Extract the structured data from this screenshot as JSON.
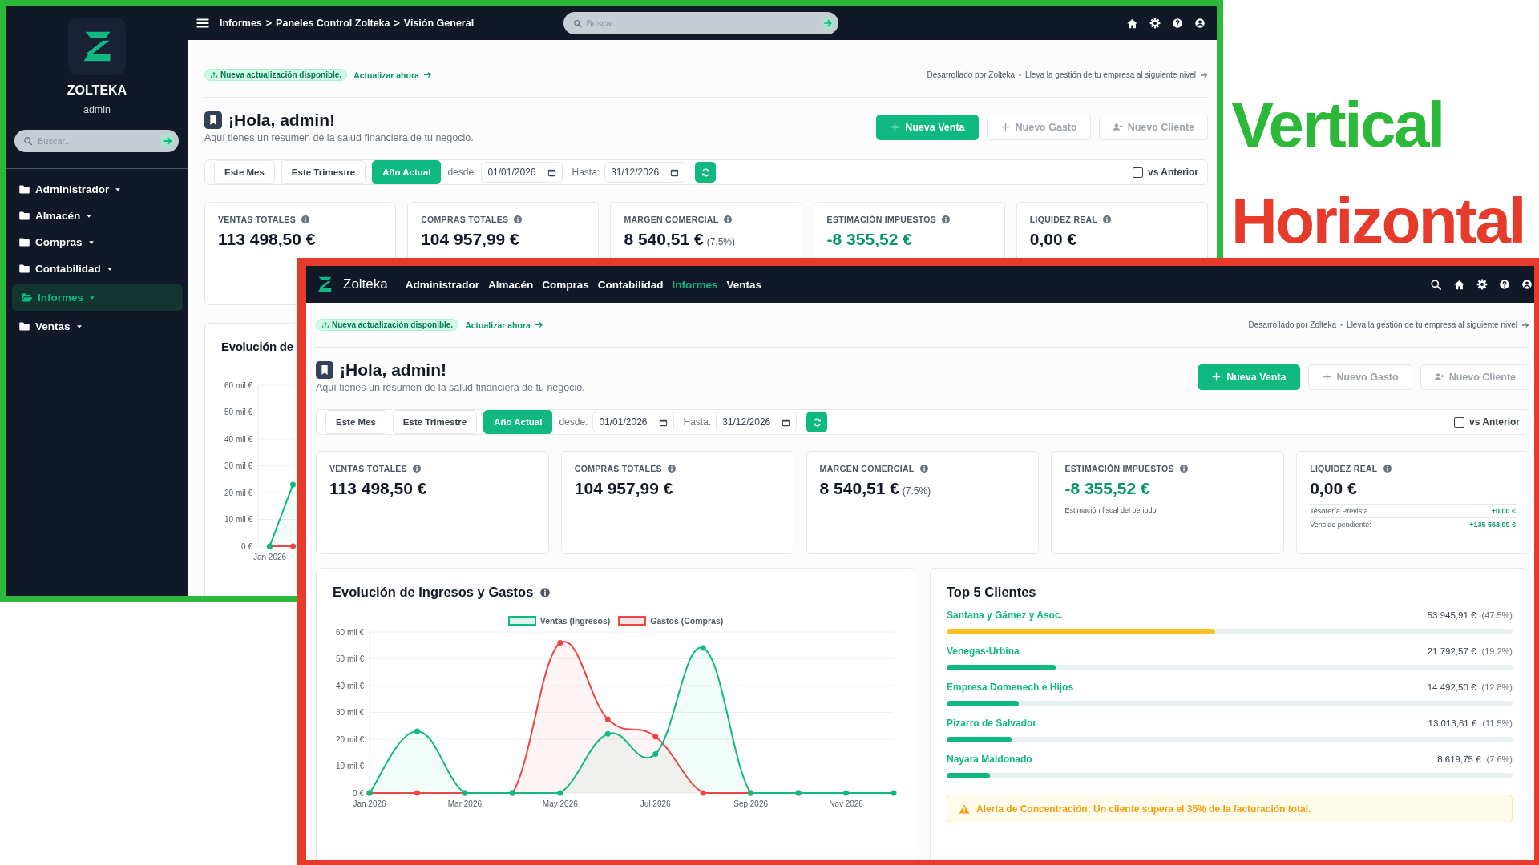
{
  "windows": [
    {
      "kind": "vertical",
      "caption": "Vertical",
      "color": "#2cb93a",
      "sidebar": {
        "brand": "ZOLTEKA",
        "user": "admin",
        "search": {
          "placeholder": "Buscar..."
        },
        "items": [
          {
            "label": "Administrador",
            "selected": false
          },
          {
            "label": "Almacén",
            "selected": false
          },
          {
            "label": "Compras",
            "selected": false
          },
          {
            "label": "Contabilidad",
            "selected": false
          },
          {
            "label": "Informes",
            "selected": true
          },
          {
            "label": "Ventas",
            "selected": false
          }
        ]
      },
      "topbar": {
        "breadcrumb": [
          {
            "label": "Informes",
            "kind": "crumb"
          },
          {
            "label": ">",
            "kind": "separator"
          },
          {
            "label": "Paneles Control Zolteka",
            "kind": "crumb"
          },
          {
            "label": ">",
            "kind": "separator"
          },
          {
            "label": "Visión General",
            "kind": "crumb"
          }
        ],
        "search": {
          "placeholder": "Buscar..."
        }
      },
      "dashboard": {
        "update": {
          "badge": "Nueva actualización disponible.",
          "link": "Actualizar ahora",
          "credit": "Desarrollado por Zolteka",
          "tagline": "Lleva la gestión de tu empresa al siguiente nivel"
        },
        "greeting": {
          "title": "¡Hola, admin!",
          "subtitle": "Aquí tienes un resumen de la salud financiera de tu negocio."
        },
        "actions": [
          {
            "label": "Nueva Venta",
            "kind": "primary"
          },
          {
            "label": "Nuevo Gasto",
            "kind": "secondary"
          },
          {
            "label": "Nuevo Cliente",
            "kind": "contact"
          }
        ],
        "filters": {
          "presets": [
            {
              "label": "Este Mes",
              "selected": false
            },
            {
              "label": "Este Trimestre",
              "selected": false
            },
            {
              "label": "Año Actual",
              "selected": true
            }
          ],
          "from_label": "desde:",
          "from": "01/01/2026",
          "to_label": "Hasta:",
          "to": "31/12/2026",
          "compare": {
            "label": "vs Anterior",
            "checked": false
          }
        },
        "kpis": [
          {
            "title": "VENTAS TOTALES",
            "value": "113 498,50 €",
            "positive": false
          },
          {
            "title": "COMPRAS TOTALES",
            "value": "104 957,99 €",
            "positive": false
          },
          {
            "title": "MARGEN COMERCIAL",
            "value": "8 540,51 €",
            "change": "(7.5%)",
            "positive": false
          },
          {
            "title": "ESTIMACIÓN IMPUESTOS",
            "value": "-8 355,52 €",
            "positive": true
          },
          {
            "title": "LIQUIDEZ REAL",
            "value": "0,00 €",
            "positive": false
          }
        ],
        "evolution": {
          "title": "Evolución de",
          "chart_data": {
            "type": "line",
            "categories": [
              "Jan 2026",
              null,
              null,
              null,
              null,
              null,
              null,
              null,
              null,
              null,
              null,
              null
            ],
            "ylim": [
              0,
              60
            ],
            "yticks": [
              {
                "value": 0,
                "label": "0 €"
              },
              {
                "value": 10,
                "label": "10 mil €"
              },
              {
                "value": 20,
                "label": "20 mil €"
              },
              {
                "value": 30,
                "label": "30 mil €"
              },
              {
                "value": 40,
                "label": "40 mil €"
              },
              {
                "value": 50,
                "label": "50 mil €"
              },
              {
                "value": 60,
                "label": "60 mil €"
              }
            ],
            "grid": true,
            "series": [
              {
                "color": "#10b981",
                "marker": true,
                "values": [
                  0,
                  23,
                  null,
                  null,
                  null,
                  null,
                  null,
                  null,
                  null,
                  null,
                  null,
                  null
                ]
              },
              {
                "color": "#ef4444",
                "marker": true,
                "values": [
                  0,
                  0,
                  null,
                  null,
                  null,
                  null,
                  null,
                  null,
                  null,
                  null,
                  null,
                  null
                ]
              }
            ]
          }
        }
      }
    },
    {
      "kind": "horizontal",
      "caption": "Horizontal",
      "color": "#e63a2a",
      "topbar": {
        "brand": "Zolteka",
        "nav": [
          {
            "label": "Administrador",
            "selected": false
          },
          {
            "label": "Almacén",
            "selected": false
          },
          {
            "label": "Compras",
            "selected": false
          },
          {
            "label": "Contabilidad",
            "selected": false
          },
          {
            "label": "Informes",
            "selected": true
          },
          {
            "label": "Ventas",
            "selected": false
          }
        ]
      },
      "dashboard": {
        "update": {
          "badge": "Nueva actualización disponible.",
          "link": "Actualizar ahora",
          "credit": "Desarrollado por Zolteka",
          "tagline": "Lleva la gestión de tu empresa al siguiente nivel"
        },
        "greeting": {
          "title": "¡Hola, admin!",
          "subtitle": "Aquí tienes un resumen de la salud financiera de tu negocio."
        },
        "actions": [
          {
            "label": "Nueva Venta",
            "kind": "primary"
          },
          {
            "label": "Nuevo Gasto",
            "kind": "secondary"
          },
          {
            "label": "Nuevo Cliente",
            "kind": "contact"
          }
        ],
        "filters": {
          "presets": [
            {
              "label": "Este Mes",
              "selected": false
            },
            {
              "label": "Este Trimestre",
              "selected": false
            },
            {
              "label": "Año Actual",
              "selected": true
            }
          ],
          "from_label": "desde:",
          "from": "01/01/2026",
          "to_label": "Hasta:",
          "to": "31/12/2026",
          "compare": {
            "label": "vs Anterior",
            "checked": false
          }
        },
        "kpis": [
          {
            "title": "VENTAS TOTALES",
            "value": "113 498,50 €",
            "positive": false
          },
          {
            "title": "COMPRAS TOTALES",
            "value": "104 957,99 €",
            "positive": false
          },
          {
            "title": "MARGEN COMERCIAL",
            "value": "8 540,51 €",
            "change": "(7.5%)",
            "positive": false
          },
          {
            "title": "ESTIMACIÓN IMPUESTOS",
            "value": "-8 355,52 €",
            "positive": true,
            "note": "Estimación fiscal del periodo"
          },
          {
            "title": "LIQUIDEZ REAL",
            "value": "0,00 €",
            "positive": false,
            "rows": [
              {
                "label": "Tesorería Prevista",
                "value": "+0,00 €"
              },
              {
                "label": "Vencido pendiente:",
                "value": "+135 563,09 €"
              }
            ]
          }
        ],
        "evolution": {
          "title": "Evolución de Ingresos y Gastos",
          "chart_data": {
            "type": "line",
            "categories": [
              "Jan 2026",
              null,
              "Mar 2026",
              null,
              "May 2026",
              null,
              "Jul 2026",
              null,
              "Sep 2026",
              null,
              "Nov 2026",
              null
            ],
            "ylim": [
              0,
              60
            ],
            "yticks": [
              {
                "value": 0,
                "label": "0 €"
              },
              {
                "value": 10,
                "label": "10 mil €"
              },
              {
                "value": 20,
                "label": "20 mil €"
              },
              {
                "value": 30,
                "label": "30 mil €"
              },
              {
                "value": 40,
                "label": "40 mil €"
              },
              {
                "value": 50,
                "label": "50 mil €"
              },
              {
                "value": 60,
                "label": "60 mil €"
              }
            ],
            "grid": true,
            "legend": true,
            "series": [
              {
                "name": "Ventas (Ingresos)",
                "color": "#10b981",
                "marker": true,
                "values": [
                  0,
                  23,
                  0,
                  0,
                  0,
                  22,
                  14.5,
                  54,
                  0,
                  0,
                  0,
                  0
                ]
              },
              {
                "name": "Gastos (Compras)",
                "color": "#ef4444",
                "marker": true,
                "values": [
                  0,
                  0,
                  0,
                  0,
                  56,
                  27.5,
                  21,
                  0,
                  0,
                  0,
                  null,
                  null
                ]
              }
            ]
          }
        },
        "top_clients": {
          "title": "Top 5 Clientes",
          "clients": [
            {
              "name": "Santana y Gámez y Asoc.",
              "amount": "53 945,91 €",
              "share": "(47.5%)",
              "level": 0.475,
              "color": "#fbbf24"
            },
            {
              "name": "Venegas-Urbina",
              "amount": "21 792,57 €",
              "share": "(19.2%)",
              "level": 0.192,
              "color": "#10b981"
            },
            {
              "name": "Empresa Domenech e Hijos",
              "amount": "14 492,50 €",
              "share": "(12.8%)",
              "level": 0.128,
              "color": "#10b981"
            },
            {
              "name": "Pizarro de Salvador",
              "amount": "13 013,61 €",
              "share": "(11.5%)",
              "level": 0.115,
              "color": "#10b981"
            },
            {
              "name": "Nayara Maldonado",
              "amount": "8 619,75 €",
              "share": "(7.6%)",
              "level": 0.076,
              "color": "#10b981"
            }
          ],
          "alert": "Alerta de Concentración: Un cliente supera el 35% de la facturación total."
        }
      }
    }
  ]
}
